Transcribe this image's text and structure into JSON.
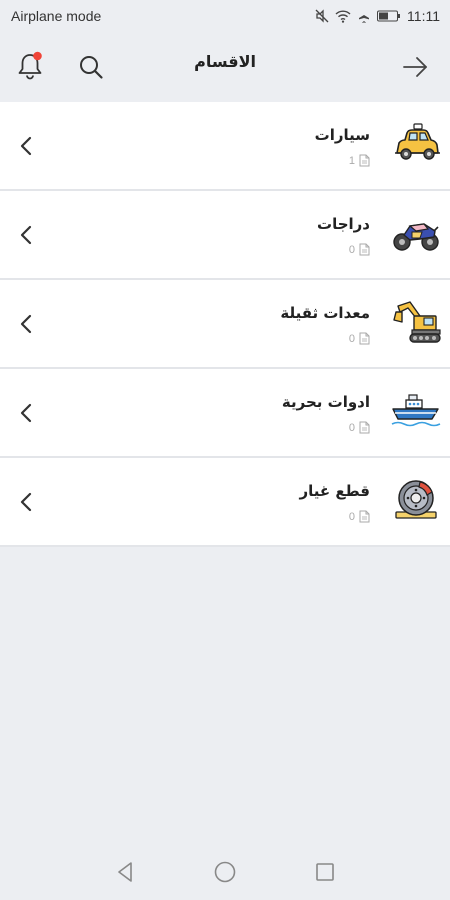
{
  "status": {
    "mode": "Airplane mode",
    "time": "11:11"
  },
  "header": {
    "title": "الاقسام",
    "notification_dot_color": "#f04438",
    "icons": [
      "bell-icon",
      "search-icon",
      "arrow-right-icon"
    ]
  },
  "categories": [
    {
      "name": "سيارات",
      "count": "1",
      "icon": "car-icon"
    },
    {
      "name": "دراجات",
      "count": "0",
      "icon": "motorcycle-icon"
    },
    {
      "name": "معدات ثقيلة",
      "count": "0",
      "icon": "excavator-icon"
    },
    {
      "name": "ادوات بحرية",
      "count": "0",
      "icon": "boat-icon"
    },
    {
      "name": "قطع غيار",
      "count": "0",
      "icon": "brake-disc-icon"
    }
  ],
  "navbar": {
    "icons": [
      "back-triangle-icon",
      "home-circle-icon",
      "recents-square-icon"
    ]
  }
}
